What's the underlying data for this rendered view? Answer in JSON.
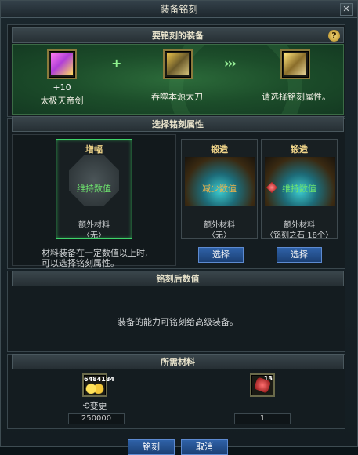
{
  "window": {
    "title": "装备铭刻",
    "close_glyph": "✕"
  },
  "sections": {
    "target_equipment": "要铭刻的装备",
    "select_attribute": "选择铭刻属性",
    "after_values": "铭刻后数值",
    "required_materials": "所需材料"
  },
  "help_glyph": "?",
  "equip_row": {
    "source_plus": "+10",
    "source_name": "太极天帝剑",
    "material_name": "吞噬本源太刀",
    "result_prompt": "请选择铭刻属性。",
    "plus_sign": "+",
    "arrows": "›››"
  },
  "attribute_cards": [
    {
      "title": "增幅",
      "status": "维持数值",
      "extra_label": "额外材料",
      "extra_value": "〈无〉",
      "selected": true
    },
    {
      "title": "锻造",
      "status": "减少数值",
      "extra_label": "额外材料",
      "extra_value": "〈无〉",
      "button": "选择"
    },
    {
      "title": "锻造",
      "status": "维持数值",
      "extra_label": "额外材料",
      "extra_value": "〈铭刻之石 18个〉",
      "button": "选择"
    }
  ],
  "info_text_line1": "材料装备在一定数值以上时,",
  "info_text_line2": "可以选择铭刻属性。",
  "after_message": "装备的能力可铭刻给高级装备。",
  "materials": {
    "gold_count": "6484184",
    "gold_change_label": "⟲变更",
    "gold_value": "250000",
    "stone_count": "13",
    "stone_value": "1"
  },
  "bottom_buttons": {
    "confirm": "铭刻",
    "cancel": "取消"
  },
  "colors": {
    "accent_green": "#6ee36e",
    "gold": "#f0d58a",
    "button_blue": "#2f62a8"
  }
}
